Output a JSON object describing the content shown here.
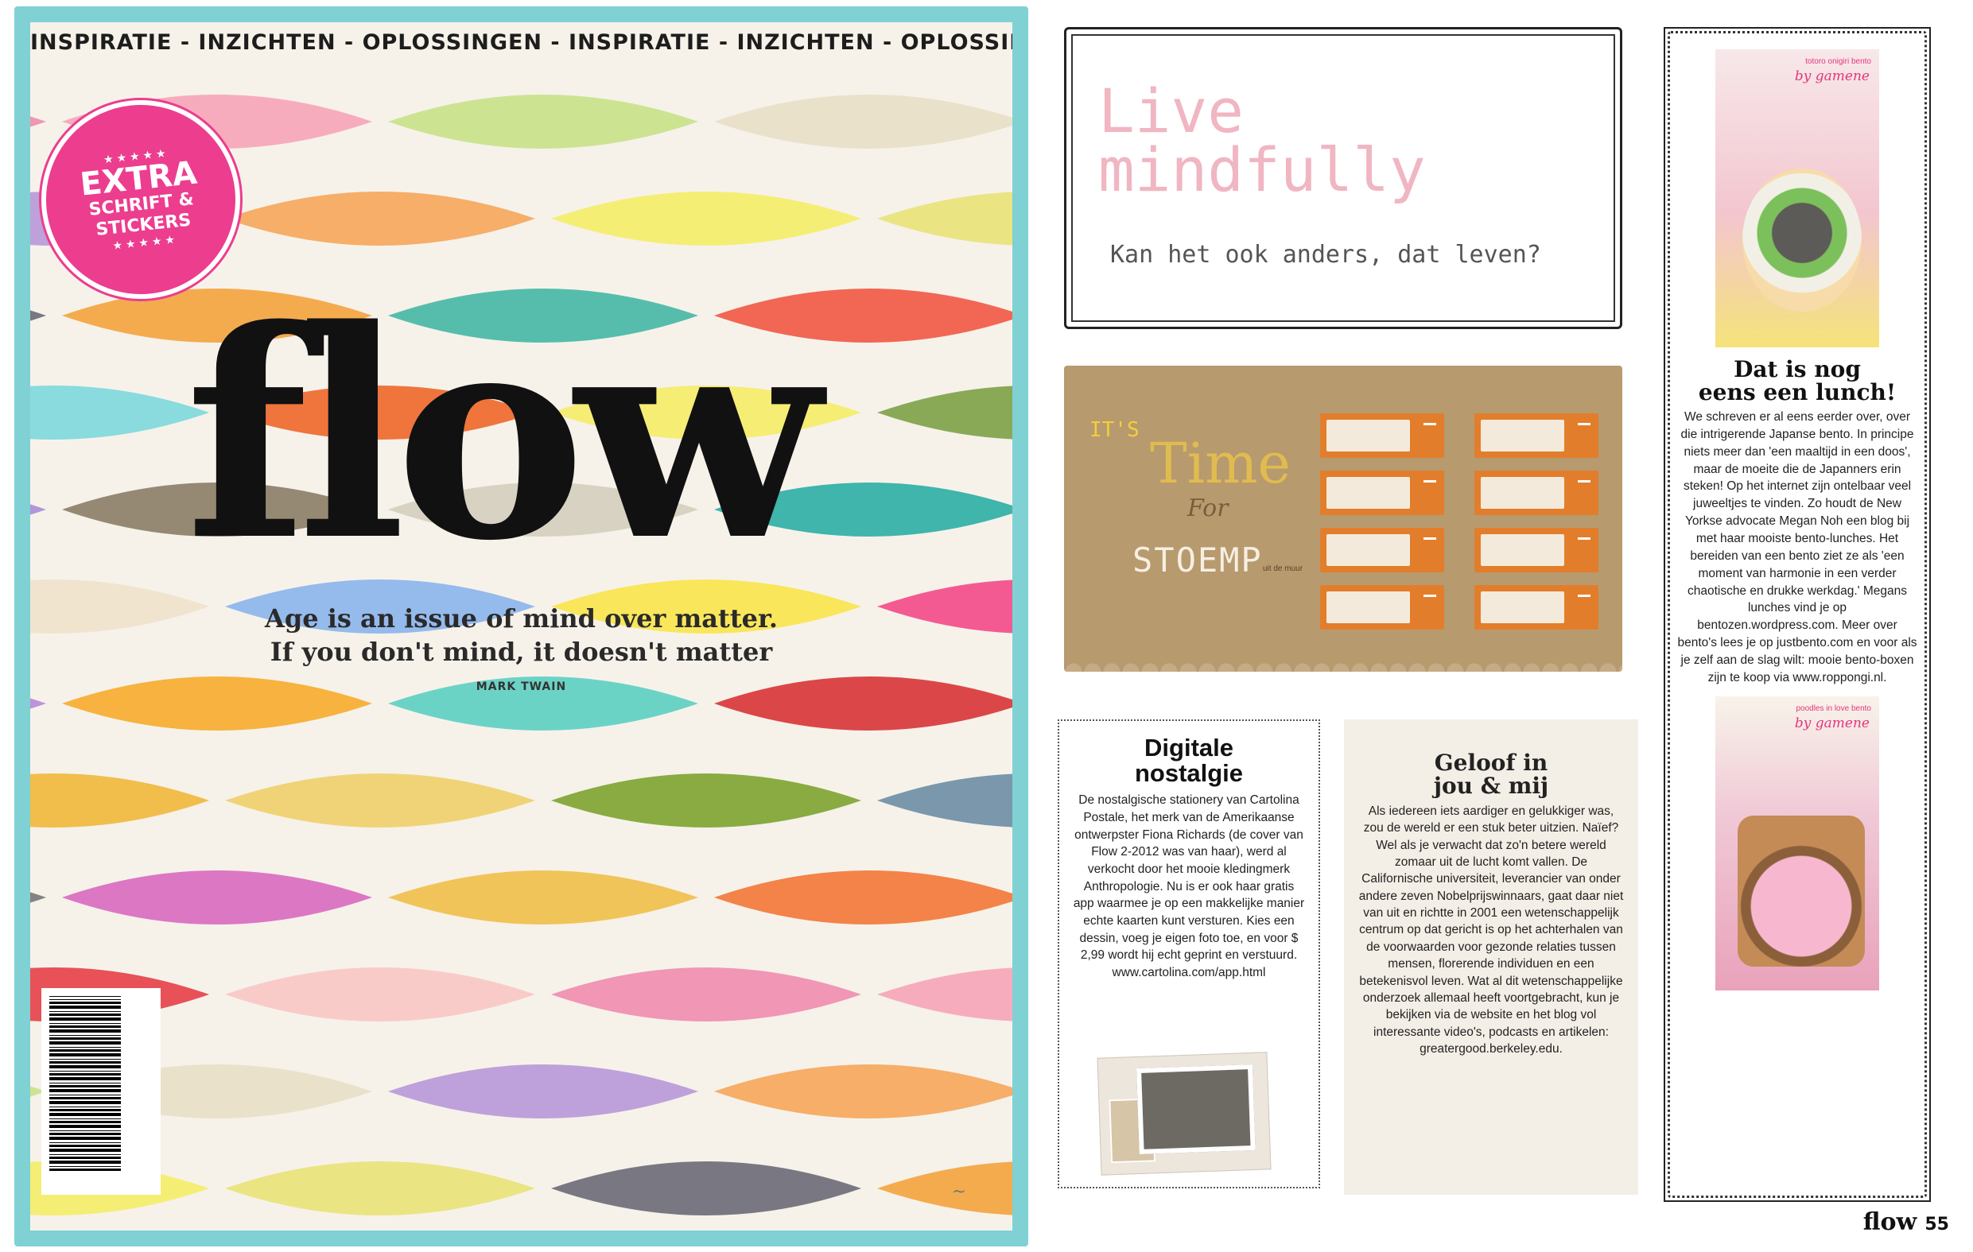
{
  "cover": {
    "tagline": "INSPIRATIE - INZICHTEN - OPLOSSINGEN - INSPIRATIE - INZICHTEN - OPLOSSINGEN",
    "badge": {
      "line1": "EXTRA",
      "line2": "SCHRIFT &",
      "line3": "STICKERS"
    },
    "logo": "flow",
    "quote_line1": "Age is an issue of mind over matter.",
    "quote_line2": "If you don't mind, it doesn't matter",
    "quote_author": "MARK TWAIN",
    "leaf_colors": [
      "#f08eb0",
      "#f6a6b8",
      "#c8e38a",
      "#e8e0c8",
      "#b89ad8",
      "#f5a85c",
      "#f4ee6a",
      "#e8e37a",
      "#6e6e78",
      "#f3a540",
      "#48b8a6",
      "#f05b46",
      "#7fd9dc",
      "#ee6a2e",
      "#f5ed6a",
      "#7fa34a",
      "#a98fd8",
      "#8c8068",
      "#d5cfbe",
      "#2fb0a6",
      "#efe3cc",
      "#8cb5eb",
      "#f8e54e",
      "#f34d8a",
      "#b88bd8",
      "#f6ac30",
      "#5ed0c2",
      "#d8383a",
      "#f0b93d",
      "#f0d06d",
      "#7fa532",
      "#6f8fa6",
      "#7a7a7a",
      "#d96cc0",
      "#f0c04c",
      "#f27a3a",
      "#e5434a",
      "#f8c8c4"
    ]
  },
  "live": {
    "title_line1": "Live",
    "title_line2": "mindfully",
    "subtitle": "Kan het ook anders, dat leven?"
  },
  "stoemp": {
    "its": "IT'S",
    "time": "Time",
    "for": "For",
    "name": "STOEMP",
    "tag": "uit de muur"
  },
  "digitale": {
    "title_line1": "Digitale",
    "title_line2": "nostalgie",
    "body": "De nostalgische stationery van Cartolina Postale, het merk van de Amerikaanse ontwerpster Fiona Richards (de cover van Flow 2-2012 was van haar), werd al verkocht door het mooie kledingmerk Anthropologie. Nu is er ook haar gratis app waarmee je op een makkelijke manier echte kaarten kunt versturen. Kies een dessin, voeg je eigen foto toe, en voor $ 2,99 wordt hij echt geprint en verstuurd. www.cartolina.com/app.html"
  },
  "geloof": {
    "title_line1": "Geloof in",
    "title_line2": "jou & mij",
    "body": "Als iedereen iets aardiger en gelukkiger was, zou de wereld er een stuk beter uitzien. Naïef? Wel als je verwacht dat zo'n betere wereld zomaar uit de lucht komt vallen. De Californische universiteit, leverancier van onder andere zeven Nobelprijswinnaars, gaat daar niet van uit en richtte in 2001 een wetenschappelijk centrum op dat gericht is op het achterhalen van de voorwaarden voor gezonde relaties tussen mensen, florerende individuen en een betekenisvol leven. Wat al dit wetenschappelijke onderzoek allemaal heeft voortgebracht, kun je bekijken via de website en het blog vol interessante video's, podcasts en artikelen: greatergood.berkeley.edu."
  },
  "bento": {
    "photo1_caption": "totoro onigiri bento",
    "photo1_by": "by gamene",
    "title_line1": "Dat is nog",
    "title_line2": "eens een lunch!",
    "body": "We schreven er al eens eerder over, over die intrigerende Japanse bento. In principe niets meer dan 'een maaltijd in een doos', maar de moeite die de Japanners erin steken! Op het internet zijn ontelbaar veel juweeltjes te vinden. Zo houdt de New Yorkse advocate Megan Noh een blog bij met haar mooiste bento-lunches. Het bereiden van een bento ziet ze als 'een moment van harmonie in een verder chaotische en drukke werkdag.' Megans lunches vind je op bentozen.wordpress.com. Meer over bento's lees je op justbento.com en voor als je zelf aan de slag wilt: mooie bento-boxen zijn te koop via www.roppongi.nl.",
    "photo2_caption": "poodles in love bento",
    "photo2_by": "by gamene"
  },
  "footer": {
    "logo": "flow",
    "page": "55"
  }
}
